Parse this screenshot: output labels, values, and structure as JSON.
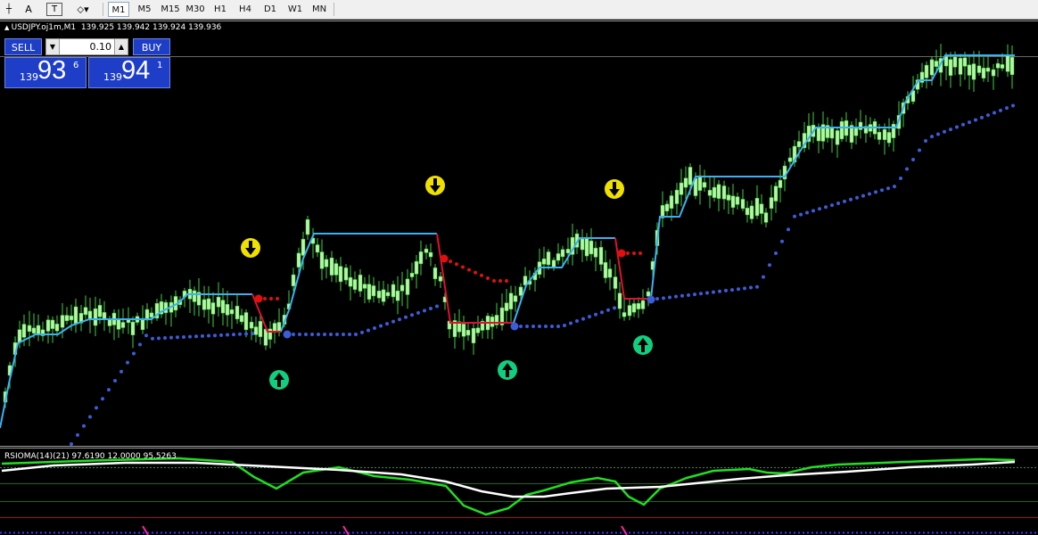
{
  "toolbar": {
    "tools": [
      {
        "name": "crosshair-tool-icon",
        "glyph": "┼"
      },
      {
        "name": "text-tool",
        "glyph": "A"
      },
      {
        "name": "text-label-tool",
        "glyph": "T"
      },
      {
        "name": "shapes-tool-icon",
        "glyph": "⬦▾"
      }
    ],
    "timeframes": [
      "M1",
      "M5",
      "M15",
      "M30",
      "H1",
      "H4",
      "D1",
      "W1",
      "MN"
    ],
    "active_timeframe": "M1"
  },
  "chart": {
    "symbol_text": "USDJPY.oj1m,M1  139.925 139.942 139.924 139.936"
  },
  "trade_panel": {
    "sell_label": "SELL",
    "buy_label": "BUY",
    "lot_value": "0.10",
    "sell_price": {
      "prefix": "139",
      "big": "93",
      "sup": "6"
    },
    "buy_price": {
      "prefix": "139",
      "big": "94",
      "sup": "1"
    }
  },
  "indicator": {
    "label": "RSIOMA(14)(21) 97.6190 12.0000 95.5263"
  },
  "colors": {
    "bull_candle": "#b5f5a5",
    "wick": "#3fd13f",
    "supertrend_up": "#3cb0f0",
    "supertrend_down": "#e01030",
    "trail_up": "#3c5cd8",
    "trail_down": "#e01010",
    "arrow_down": "#f0e000",
    "arrow_up": "#10d080",
    "rsi_fast": "#22dd22",
    "rsi_slow": "#ffffff"
  },
  "chart_data": {
    "type": "candlestick",
    "description_series": [
      "price-candles",
      "supertrend-line",
      "trailing-stop-dots",
      "rsioma-lines"
    ]
  }
}
